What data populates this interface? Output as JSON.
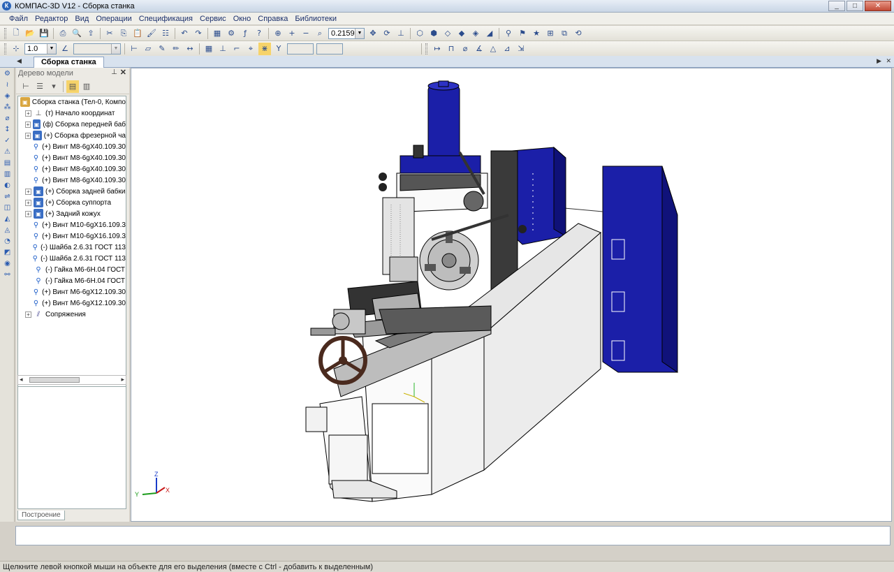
{
  "window": {
    "app_icon": "kompas-logo-icon",
    "title": "КОМПАС-3D V12 - Сборка станка",
    "buttons": [
      "_",
      "□",
      "✕"
    ]
  },
  "menu": [
    "Файл",
    "Редактор",
    "Вид",
    "Операции",
    "Спецификация",
    "Сервис",
    "Окно",
    "Справка",
    "Библиотеки"
  ],
  "toolbar1": {
    "zoom_value": "0.2159"
  },
  "toolbar2": {
    "step_value": "1.0",
    "angle_value": "",
    "x_field": "",
    "y_field": ""
  },
  "document_tab": {
    "label": "Сборка станка"
  },
  "tree_panel": {
    "title": "Дерево модели",
    "pin": "⊥",
    "close": "✕",
    "bottom_tab": "Построение",
    "items": [
      {
        "icon": "assembly-root",
        "label": "Сборка станка (Тел-0, Компо",
        "expandable": false,
        "indent": 0
      },
      {
        "icon": "origin",
        "label": "(т) Начало координат",
        "expandable": true,
        "indent": 1
      },
      {
        "icon": "assembly",
        "label": "(ф) Сборка передней баб",
        "expandable": true,
        "indent": 1
      },
      {
        "icon": "assembly",
        "label": "(+) Сборка фрезерной ча",
        "expandable": true,
        "indent": 1
      },
      {
        "icon": "part",
        "label": "(+) Винт М8-6gX40.109.30",
        "expandable": false,
        "indent": 1
      },
      {
        "icon": "part",
        "label": "(+) Винт М8-6gX40.109.30",
        "expandable": false,
        "indent": 1
      },
      {
        "icon": "part",
        "label": "(+) Винт М8-6gX40.109.30",
        "expandable": false,
        "indent": 1
      },
      {
        "icon": "part",
        "label": "(+) Винт М8-6gX40.109.30",
        "expandable": false,
        "indent": 1
      },
      {
        "icon": "assembly",
        "label": "(+) Сборка задней бабки",
        "expandable": true,
        "indent": 1
      },
      {
        "icon": "assembly",
        "label": "(+) Сборка суппорта",
        "expandable": true,
        "indent": 1
      },
      {
        "icon": "assembly",
        "label": "(+) Задний кожух",
        "expandable": true,
        "indent": 1
      },
      {
        "icon": "part",
        "label": "(+) Винт М10-6gX16.109.3",
        "expandable": false,
        "indent": 1
      },
      {
        "icon": "part",
        "label": "(+) Винт М10-6gX16.109.3",
        "expandable": false,
        "indent": 1
      },
      {
        "icon": "part",
        "label": "(-) Шайба 2.6.31 ГОСТ 113",
        "expandable": false,
        "indent": 1
      },
      {
        "icon": "part",
        "label": "(-) Шайба 2.6.31 ГОСТ 113",
        "expandable": false,
        "indent": 1
      },
      {
        "icon": "part",
        "label": "(-) Гайка  М6-6Н.04 ГОСТ",
        "expandable": false,
        "indent": 1
      },
      {
        "icon": "part",
        "label": "(-) Гайка  М6-6Н.04 ГОСТ",
        "expandable": false,
        "indent": 1
      },
      {
        "icon": "part",
        "label": "(+) Винт М6-6gX12.109.30",
        "expandable": false,
        "indent": 1
      },
      {
        "icon": "part",
        "label": "(+) Винт М6-6gX12.109.30",
        "expandable": false,
        "indent": 1
      },
      {
        "icon": "mates",
        "label": "Сопряжения",
        "expandable": true,
        "indent": 1
      }
    ]
  },
  "viewport": {
    "triad_labels": {
      "z": "Z",
      "y": "Y",
      "x": "X"
    }
  },
  "status": {
    "hint": "Щелкните левой кнопкой мыши на объекте для его выделения (вместе с Ctrl - добавить к выделенным)"
  }
}
